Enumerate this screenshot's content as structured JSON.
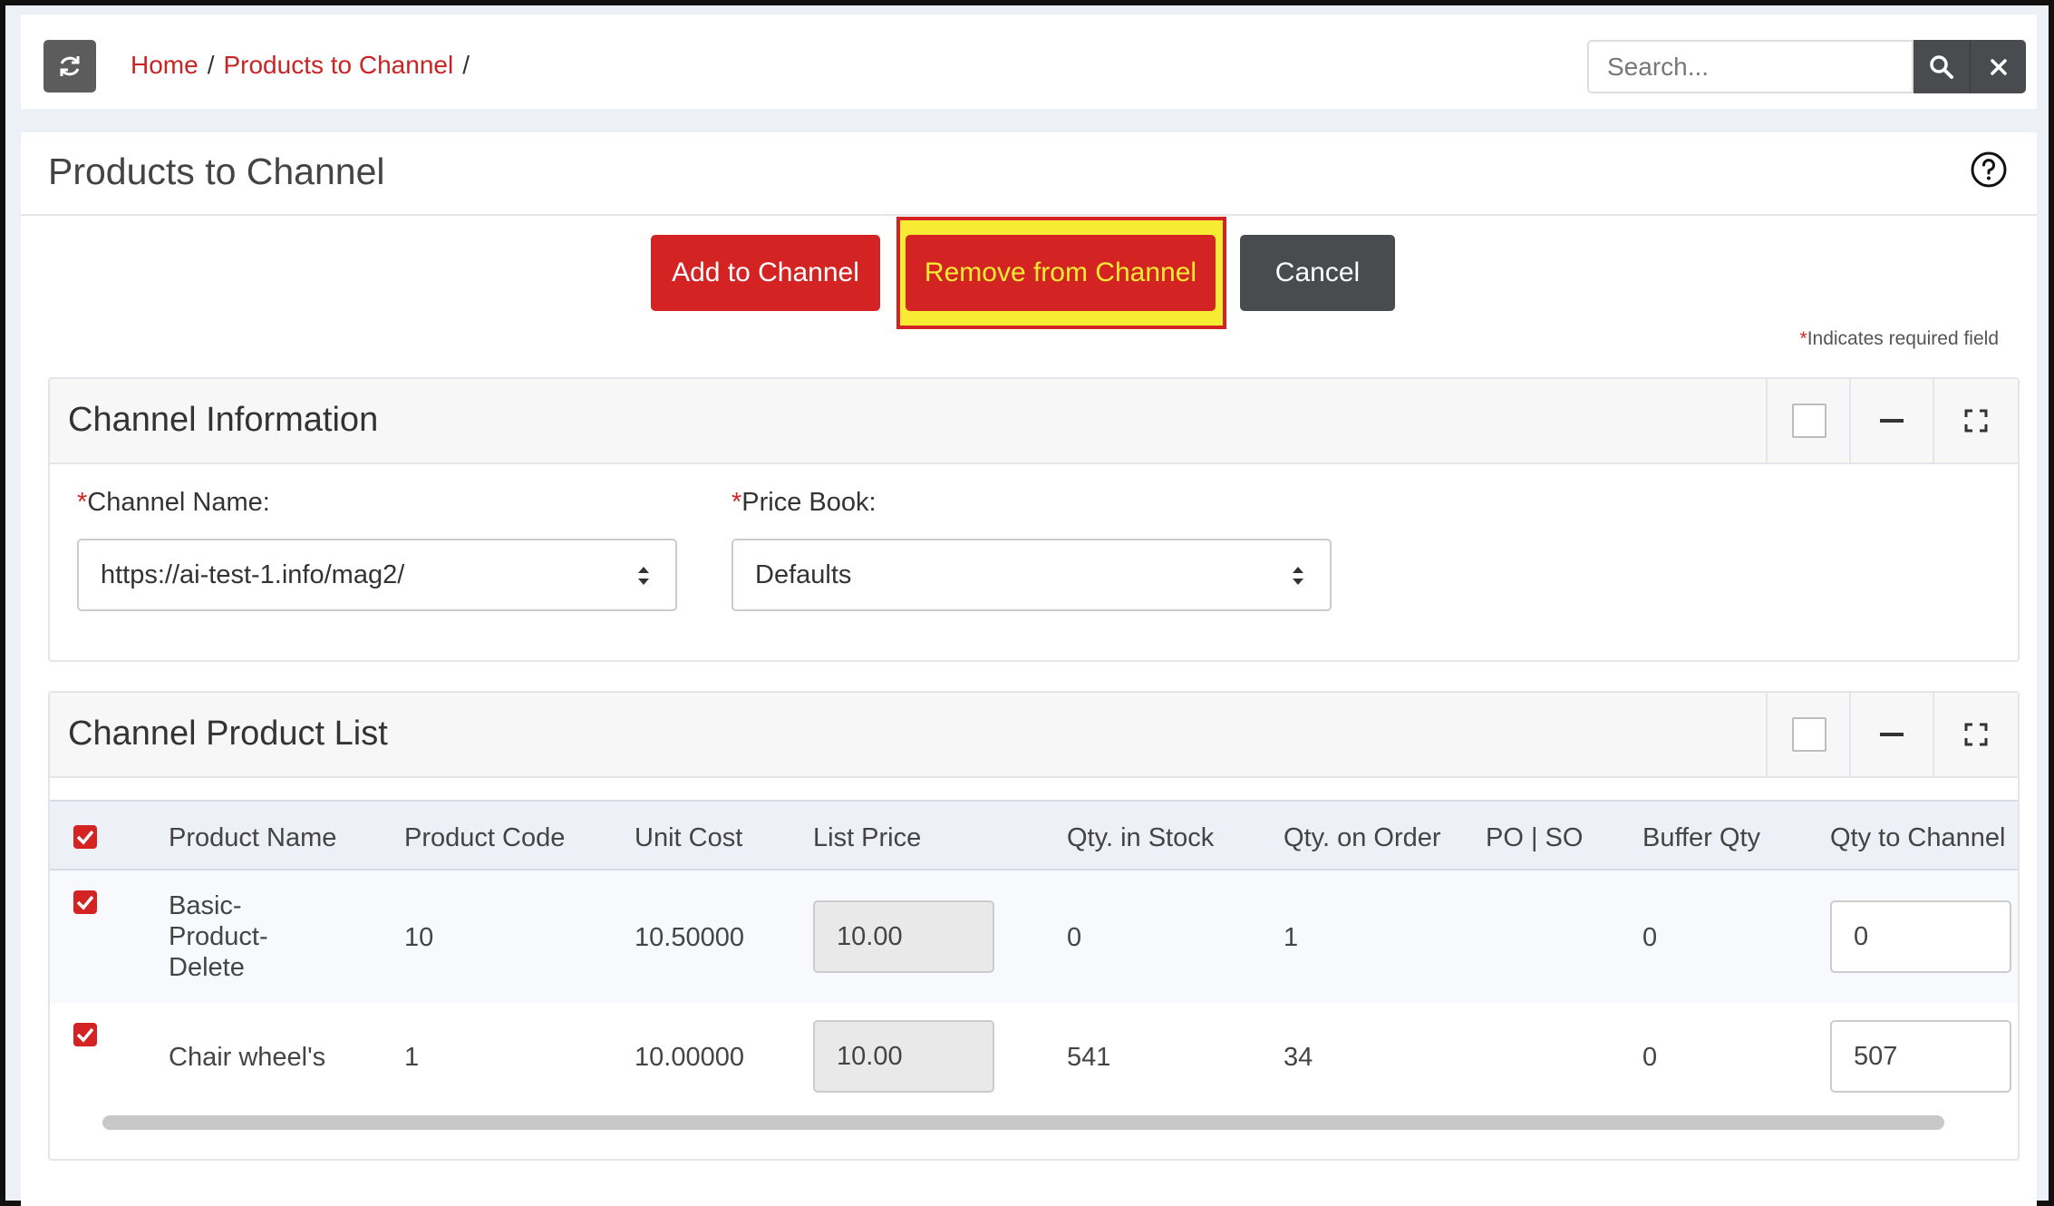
{
  "breadcrumb": {
    "home": "Home",
    "current": "Products to Channel",
    "separator": "/"
  },
  "search": {
    "placeholder": "Search..."
  },
  "page": {
    "title": "Products to Channel"
  },
  "actions": {
    "add": "Add to Channel",
    "remove": "Remove from Channel",
    "cancel": "Cancel"
  },
  "required_note": {
    "asterisk": "*",
    "text": "Indicates required field"
  },
  "channel_info": {
    "title": "Channel Information",
    "channel_name_label": "Channel Name:",
    "channel_name_value": "https://ai-test-1.info/mag2/",
    "price_book_label": "Price Book:",
    "price_book_value": "Defaults"
  },
  "product_list": {
    "title": "Channel Product List",
    "headers": {
      "product_name": "Product Name",
      "product_code": "Product Code",
      "unit_cost": "Unit Cost",
      "list_price": "List Price",
      "qty_in_stock": "Qty. in Stock",
      "qty_on_order": "Qty. on Order",
      "po_so": "PO | SO",
      "buffer_qty": "Buffer Qty",
      "qty_to_channel": "Qty to Channel"
    },
    "rows": [
      {
        "checked": true,
        "name_l1": "Basic-",
        "name_l2": "Product-",
        "name_l3": "Delete",
        "code": "10",
        "unit_cost": "10.50000",
        "list_price": "10.00",
        "qty_in_stock": "0",
        "qty_on_order": "1",
        "buffer_qty": "0",
        "qty_to_channel": "0"
      },
      {
        "checked": true,
        "name": "Chair wheel's",
        "code": "1",
        "unit_cost": "10.00000",
        "list_price": "10.00",
        "qty_in_stock": "541",
        "qty_on_order": "34",
        "buffer_qty": "0",
        "qty_to_channel": "507"
      }
    ]
  },
  "icons": {
    "refresh": "refresh-icon",
    "search": "search-icon",
    "close": "close-icon",
    "help": "help-circle-icon",
    "minimize": "minimize-icon",
    "expand": "expand-icon"
  },
  "colors": {
    "accent": "#d42323",
    "highlight": "#f7ec33",
    "dark_button": "#4a4b4e"
  }
}
